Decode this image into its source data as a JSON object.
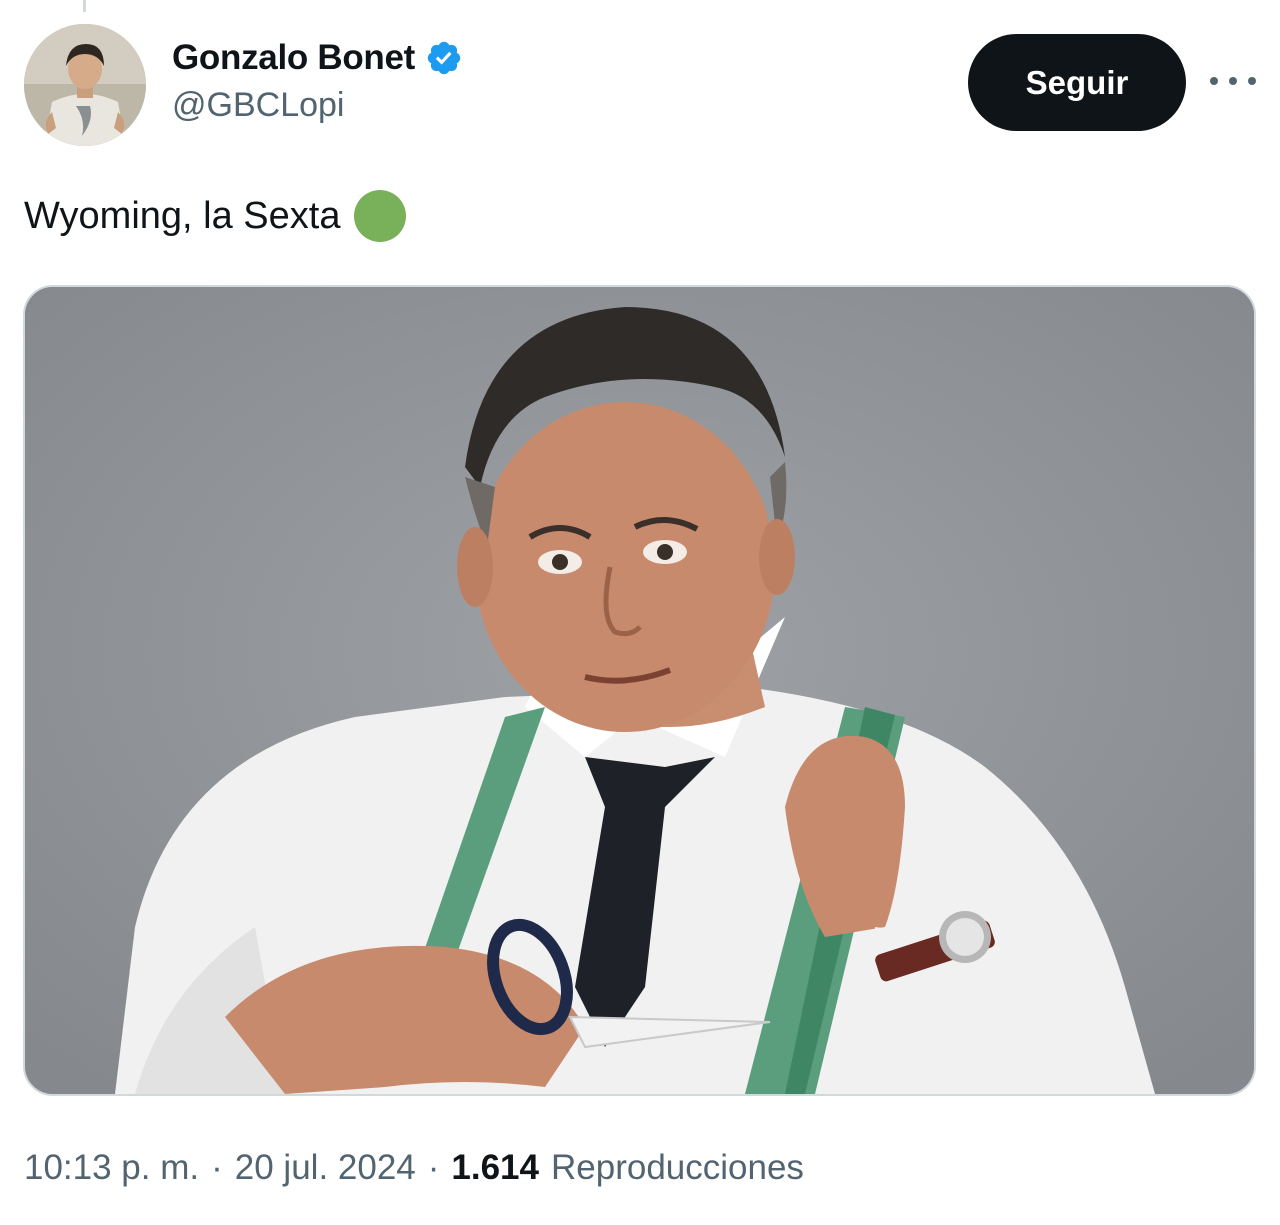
{
  "author": {
    "display_name": "Gonzalo Bonet",
    "handle": "@GBCLopi",
    "verified_icon": "verified-badge-icon",
    "verified_color": "#1d9bf0"
  },
  "actions": {
    "follow_label": "Seguir",
    "more_icon": "more-horizontal-icon"
  },
  "tweet": {
    "text": "Wyoming, la Sexta",
    "emoji": "green-circle-emoji"
  },
  "meta": {
    "time": "10:13 p. m.",
    "separator": "·",
    "date": "20 jul. 2024",
    "views_count": "1.614",
    "views_label": "Reproducciones"
  },
  "colors": {
    "text_primary": "#0f1419",
    "text_secondary": "#536471",
    "follow_bg": "#0f1419",
    "emoji_green": "#78b159"
  }
}
